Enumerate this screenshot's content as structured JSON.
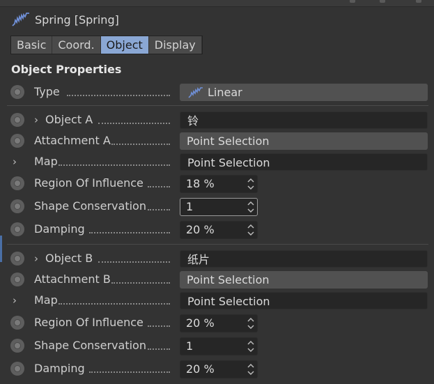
{
  "header": {
    "title": "Spring [Spring]"
  },
  "tabs": [
    {
      "label": "Basic",
      "active": false
    },
    {
      "label": "Coord.",
      "active": false
    },
    {
      "label": "Object",
      "active": true
    },
    {
      "label": "Display",
      "active": false
    }
  ],
  "section": {
    "title": "Object Properties"
  },
  "type_row": {
    "label": "Type",
    "value": "Linear"
  },
  "object_a": {
    "label": "Object A",
    "value": "铃",
    "attachment": {
      "label": "Attachment A",
      "value": "Point Selection"
    },
    "map": {
      "label": "Map",
      "value": "Point Selection"
    },
    "region": {
      "label": "Region Of Influence",
      "value": "18 %"
    },
    "shape": {
      "label": "Shape Conservation",
      "value": "1"
    },
    "damping": {
      "label": "Damping",
      "value": "20 %"
    }
  },
  "object_b": {
    "label": "Object B",
    "value": "纸片",
    "attachment": {
      "label": "Attachment B",
      "value": "Point Selection"
    },
    "map": {
      "label": "Map",
      "value": "Point Selection"
    },
    "region": {
      "label": "Region Of Influence",
      "value": "20 %"
    },
    "shape": {
      "label": "Shape Conservation",
      "value": "1"
    },
    "damping": {
      "label": "Damping",
      "value": "20 %"
    }
  },
  "colors": {
    "accent_tab": "#8aa7d4",
    "icon_blue": "#6f8fd6"
  }
}
